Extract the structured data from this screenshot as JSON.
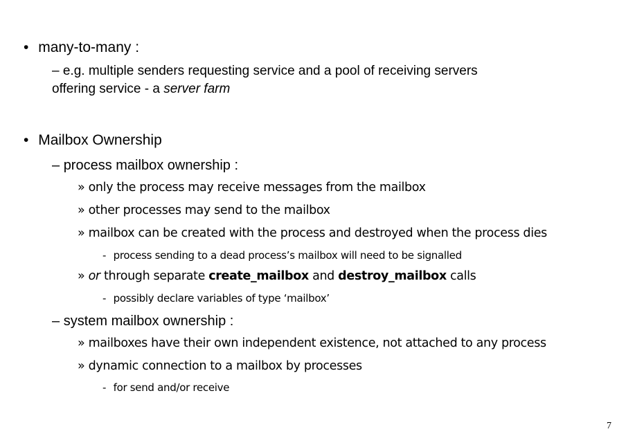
{
  "slide": {
    "page_number": "7",
    "items": [
      {
        "bullet": "•",
        "text": "many-to-many :"
      },
      {
        "dash": "–",
        "line1_text": "e.g. multiple senders requesting service and a pool of receiving servers",
        "line2_text": "offering service - a ",
        "line2_italic": "server farm"
      },
      {
        "bullet": "•",
        "text": "Mailbox Ownership"
      },
      {
        "dash": "–",
        "text": "process mailbox ownership :"
      },
      {
        "marker": "»",
        "text": "only the process may receive messages from the mailbox"
      },
      {
        "marker": "»",
        "text": "other processes may send to the mailbox"
      },
      {
        "marker": "»",
        "text": "mailbox can be created with the process and destroyed when the process dies"
      },
      {
        "marker": "-",
        "text": "process sending to a dead process’s mailbox will need to be signalled"
      },
      {
        "marker": "»",
        "italic_prefix": "or",
        "text_a": " through separate ",
        "bold_a": "create_mailbox",
        "text_b": " and ",
        "bold_b": "destroy_mailbox",
        "text_c": " calls"
      },
      {
        "marker": "-",
        "text": "possibly declare variables of type ‘mailbox’"
      },
      {
        "dash": "–",
        "text": "system mailbox ownership :"
      },
      {
        "marker": "»",
        "text": "mailboxes have their own independent existence, not attached to any process"
      },
      {
        "marker": "»",
        "text": "dynamic connection to a mailbox by processes"
      },
      {
        "marker": "-",
        "text": "for send and/or receive"
      }
    ]
  }
}
